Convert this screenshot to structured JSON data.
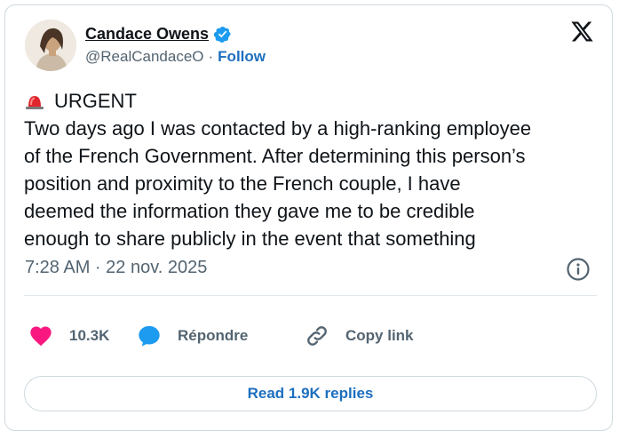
{
  "author": {
    "name": "Candace Owens",
    "handle": "@RealCandaceO",
    "separator": "·",
    "follow_label": "Follow"
  },
  "tweet": {
    "label": "URGENT",
    "body": "Two days ago I was contacted by a high-ranking employee\nof the French Government. After determining this person’s\nposition and proximity to the French couple, I have\ndeemed the information they gave me to be credible\nenough to share publicly in the event that something",
    "timestamp": "7:28 AM · 22 nov. 2025"
  },
  "actions": {
    "likes": "10.3K",
    "reply_label": "Répondre",
    "copy_link_label": "Copy link"
  },
  "footer": {
    "read_replies_label": "Read 1.9K replies"
  },
  "icons": {
    "logo": "x-logo-icon",
    "verified": "verified-badge-icon",
    "alarm": "police-light-icon",
    "info": "info-icon",
    "like": "heart-icon",
    "reply": "speech-bubble-icon",
    "link": "link-icon"
  },
  "colors": {
    "link_blue": "#1d6fbf",
    "verified_blue": "#1d9bf0",
    "heart_pink": "#f91880",
    "muted_text": "#536471"
  }
}
